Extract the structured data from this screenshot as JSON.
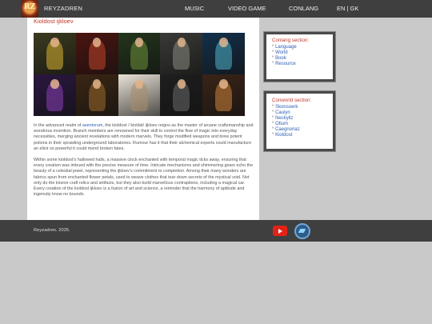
{
  "brand": {
    "name": "REYZADREN",
    "logo_text": "RZ"
  },
  "nav": [
    {
      "label": "MUSIC"
    },
    {
      "label": "VIDEO GAME"
    },
    {
      "label": "CONLANG"
    },
    {
      "label": "EN | GK"
    }
  ],
  "main": {
    "title": "Kioldost ijkloev",
    "paragraph1": {
      "before": "In the advanced realm of ",
      "link": "asentorum",
      "after": ", the kioldost /ˈkioldst/ ijkloev reigns as the master of arcane craftsmanship and wondrous invention. Branch members are renowned for their skill to control the flow of magic into everyday necessities, merging ancient revelations with modern marvels. They forge modified weapons and brew potent potions in their sprawling underground laboratories. Rumour has it that their alchemical experts could manufacture an elixir so powerful it could mend broken fates."
    },
    "paragraph2": "Within some kioldost’s hallowed halls, a massive clock enchanted with temporal magic ticks away, ensuring that every creation was imbued with the precise measure of time. Intricate mechanisms and shimmering gears echo the beauty of a celestial jewel, representing the ijkloev’s commitment to completion. Among their many wonders are fabrics spun from enchanted flower petals, used to weave clothes that tear down secrets of the mystical void. Not only do the kioeve craft relics and artifacts, but they also build marvellous contraptions, including a magical car. Every creation of the kioldost ijkloev is a fusion of art and science, a reminder that the harmony of aptitude and ingenuity know no bounds."
  },
  "gallery": [
    {
      "bg": "#3b3a1e",
      "fig": "#d9b233"
    },
    {
      "bg": "#4a1410",
      "fig": "#c0442a"
    },
    {
      "bg": "#23351c",
      "fig": "#6e8f3a"
    },
    {
      "bg": "#3a3a38",
      "fig": "#8a8a80"
    },
    {
      "bg": "#12304a",
      "fig": "#4fb3c8"
    },
    {
      "bg": "#2a1740",
      "fig": "#8a3fb8"
    },
    {
      "bg": "#3a2614",
      "fig": "#9a6a2c"
    },
    {
      "bg": "#e8e2d6",
      "fig": "#a78c6a"
    },
    {
      "bg": "#1e1e1e",
      "fig": "#6a6a6a"
    },
    {
      "bg": "#3a2418",
      "fig": "#d0853a"
    }
  ],
  "sidebar": {
    "conlang": {
      "title": "Conlang section:",
      "items": [
        "Language",
        "World",
        "Book",
        "Resource"
      ]
    },
    "conworld": {
      "title": "Conworld section:",
      "items": [
        "Skonsoerk",
        "Cauiyn",
        "Neckyliz",
        "Otium",
        "Caegnoriaz",
        "Kioldost"
      ]
    }
  },
  "footer": {
    "copyright": "Reyzadren. 2025."
  },
  "colors": {
    "bar": "#3f3f3f",
    "accent": "#c0392b",
    "link": "#2f5fb3",
    "youtube": "#e62117",
    "itch": "#2f5b87"
  },
  "icons": {
    "youtube": "youtube-icon",
    "itch": "itch-io-icon"
  }
}
